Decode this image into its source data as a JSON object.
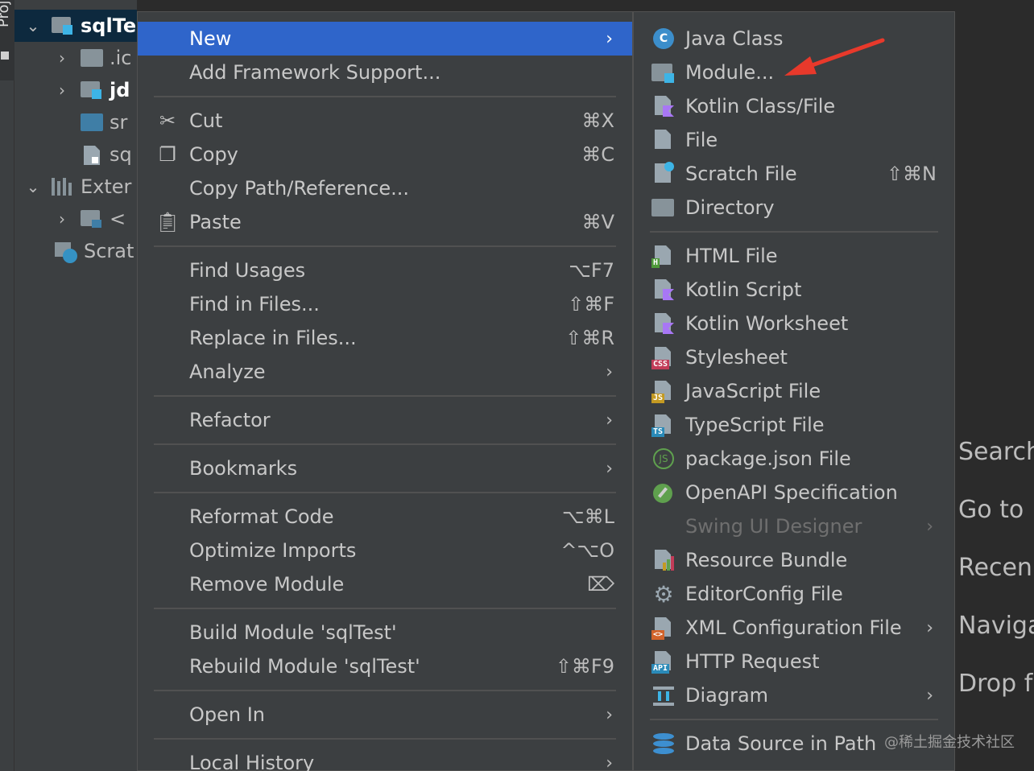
{
  "tool_window": {
    "label": "Proj"
  },
  "project_tree": [
    {
      "label": "sqlTe",
      "expanded": true,
      "bold": true,
      "selected": true
    },
    {
      "label": ".ic",
      "expanded": false
    },
    {
      "label": "jd",
      "expanded": false,
      "bold": true
    },
    {
      "label": "sr"
    },
    {
      "label": "sq"
    },
    {
      "label": "Exter",
      "expanded": true
    },
    {
      "label": "< ",
      "expanded": false
    },
    {
      "label": "Scrat"
    }
  ],
  "context_menu": {
    "items": [
      {
        "label": "New",
        "shortcut": "",
        "submenu": true,
        "active": true
      },
      {
        "label": "Add Framework Support...",
        "shortcut": ""
      },
      {
        "label": "Cut",
        "shortcut": "⌘X",
        "icon": "scissors-icon"
      },
      {
        "label": "Copy",
        "shortcut": "⌘C",
        "icon": "copy-icon"
      },
      {
        "label": "Copy Path/Reference...",
        "shortcut": ""
      },
      {
        "label": "Paste",
        "shortcut": "⌘V",
        "icon": "paste-icon"
      },
      {
        "label": "Find Usages",
        "shortcut": "⌥F7"
      },
      {
        "label": "Find in Files...",
        "shortcut": "⇧⌘F"
      },
      {
        "label": "Replace in Files...",
        "shortcut": "⇧⌘R"
      },
      {
        "label": "Analyze",
        "submenu": true
      },
      {
        "label": "Refactor",
        "submenu": true
      },
      {
        "label": "Bookmarks",
        "submenu": true
      },
      {
        "label": "Reformat Code",
        "shortcut": "⌥⌘L"
      },
      {
        "label": "Optimize Imports",
        "shortcut": "^⌥O"
      },
      {
        "label": "Remove Module",
        "shortcut": "⌦"
      },
      {
        "label": "Build Module 'sqlTest'",
        "shortcut": ""
      },
      {
        "label": "Rebuild Module 'sqlTest'",
        "shortcut": "⇧⌘F9"
      },
      {
        "label": "Open In",
        "submenu": true
      },
      {
        "label": "Local History",
        "submenu": true
      }
    ]
  },
  "new_submenu": {
    "items": [
      {
        "label": "Java Class",
        "icon": "java-class-icon"
      },
      {
        "label": "Module...",
        "icon": "module-icon"
      },
      {
        "label": "Kotlin Class/File",
        "icon": "kotlin-file-icon"
      },
      {
        "label": "File",
        "icon": "file-icon"
      },
      {
        "label": "Scratch File",
        "shortcut": "⇧⌘N",
        "icon": "scratch-file-icon"
      },
      {
        "label": "Directory",
        "icon": "directory-icon"
      },
      {
        "label": "HTML File",
        "icon": "html-file-icon",
        "badge": "H"
      },
      {
        "label": "Kotlin Script",
        "icon": "kotlin-script-icon"
      },
      {
        "label": "Kotlin Worksheet",
        "icon": "kotlin-worksheet-icon"
      },
      {
        "label": "Stylesheet",
        "icon": "css-file-icon",
        "badge": "CSS"
      },
      {
        "label": "JavaScript File",
        "icon": "js-file-icon",
        "badge": "JS"
      },
      {
        "label": "TypeScript File",
        "icon": "ts-file-icon",
        "badge": "TS"
      },
      {
        "label": "package.json File",
        "icon": "nodejs-icon"
      },
      {
        "label": "OpenAPI Specification",
        "icon": "openapi-icon"
      },
      {
        "label": "Swing UI Designer",
        "submenu": true,
        "disabled": true
      },
      {
        "label": "Resource Bundle",
        "icon": "resource-bundle-icon"
      },
      {
        "label": "EditorConfig File",
        "icon": "gear-icon"
      },
      {
        "label": "XML Configuration File",
        "submenu": true,
        "icon": "xml-file-icon",
        "badge": "<>"
      },
      {
        "label": "HTTP Request",
        "icon": "http-request-icon",
        "badge": "API"
      },
      {
        "label": "Diagram",
        "submenu": true,
        "icon": "diagram-icon"
      },
      {
        "label": "Data Source in Path",
        "icon": "database-icon"
      }
    ]
  },
  "welcome_hints": [
    "Search",
    "Go to",
    "Recen",
    "Naviga",
    "Drop f"
  ],
  "watermark": "@稀土掘金技术社区",
  "colors": {
    "menu_bg": "#3c3f41",
    "active": "#2f65ca",
    "editor_bg": "#2b2b2b",
    "annotation": "#e8392b"
  }
}
